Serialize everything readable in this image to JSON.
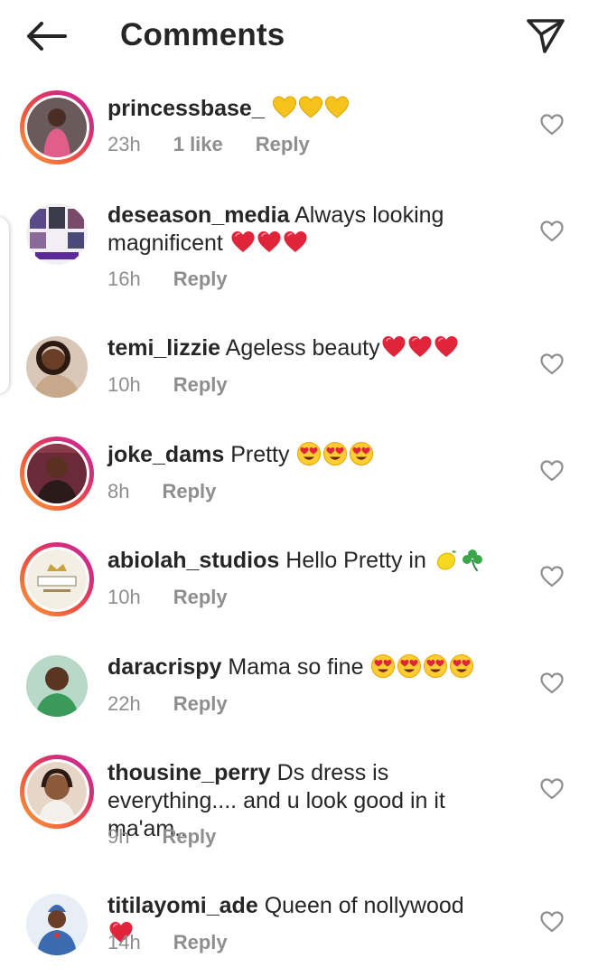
{
  "header": {
    "title": "Comments",
    "back_icon": "arrow-left-icon",
    "share_icon": "paper-plane-icon"
  },
  "comments": [
    {
      "username": "princessbase_",
      "text": "",
      "emoji": [
        "yellow-heart",
        "yellow-heart",
        "yellow-heart"
      ],
      "time": "23h",
      "likes": "1 like",
      "reply": "Reply",
      "story_ring": true,
      "avatar_color": "#e05f8a"
    },
    {
      "username": "deseason_media",
      "text": "Always looking magnificent",
      "emoji": [
        "red-heart",
        "red-heart",
        "red-heart"
      ],
      "time": "16h",
      "likes": "",
      "reply": "Reply",
      "story_ring": false,
      "avatar_color": "#5a4a8a"
    },
    {
      "username": "temi_lizzie",
      "text": "Ageless beauty",
      "emoji": [
        "red-heart",
        "red-heart",
        "red-heart"
      ],
      "time": "10h",
      "likes": "",
      "reply": "Reply",
      "story_ring": false,
      "avatar_color": "#8a5a3c"
    },
    {
      "username": "joke_dams",
      "text": "Pretty",
      "emoji": [
        "heart-eyes",
        "heart-eyes",
        "heart-eyes"
      ],
      "time": "8h",
      "likes": "",
      "reply": "Reply",
      "story_ring": true,
      "avatar_color": "#a03a4a"
    },
    {
      "username": "abiolah_studios",
      "text": "Hello Pretty in",
      "emoji": [
        "lemon",
        "shamrock"
      ],
      "time": "10h",
      "likes": "",
      "reply": "Reply",
      "story_ring": true,
      "avatar_color": "#f4efe4"
    },
    {
      "username": "daracrispy",
      "text": "Mama so fine",
      "emoji": [
        "heart-eyes",
        "heart-eyes",
        "heart-eyes",
        "heart-eyes"
      ],
      "time": "22h",
      "likes": "",
      "reply": "Reply",
      "story_ring": false,
      "avatar_color": "#4a8a5c"
    },
    {
      "username": "thousine_perry",
      "text": "Ds dress is everything.... and u look good in it ma'am...",
      "emoji": [],
      "time": "9h",
      "likes": "",
      "reply": "Reply",
      "story_ring": true,
      "avatar_color": "#9a6a4c"
    },
    {
      "username": "titilayomi_ade",
      "text": "Queen of nollywood",
      "emoji": [
        "red-heart"
      ],
      "time": "14h",
      "likes": "",
      "reply": "Reply",
      "story_ring": false,
      "avatar_color": "#3a6ab0"
    }
  ],
  "colors": {
    "text": "#262626",
    "secondary": "#8e8e8e",
    "ring_start": "#f7a23b",
    "ring_end": "#c22ea6",
    "red_heart": "#e0243a",
    "yellow_heart": "#f6c21c"
  }
}
